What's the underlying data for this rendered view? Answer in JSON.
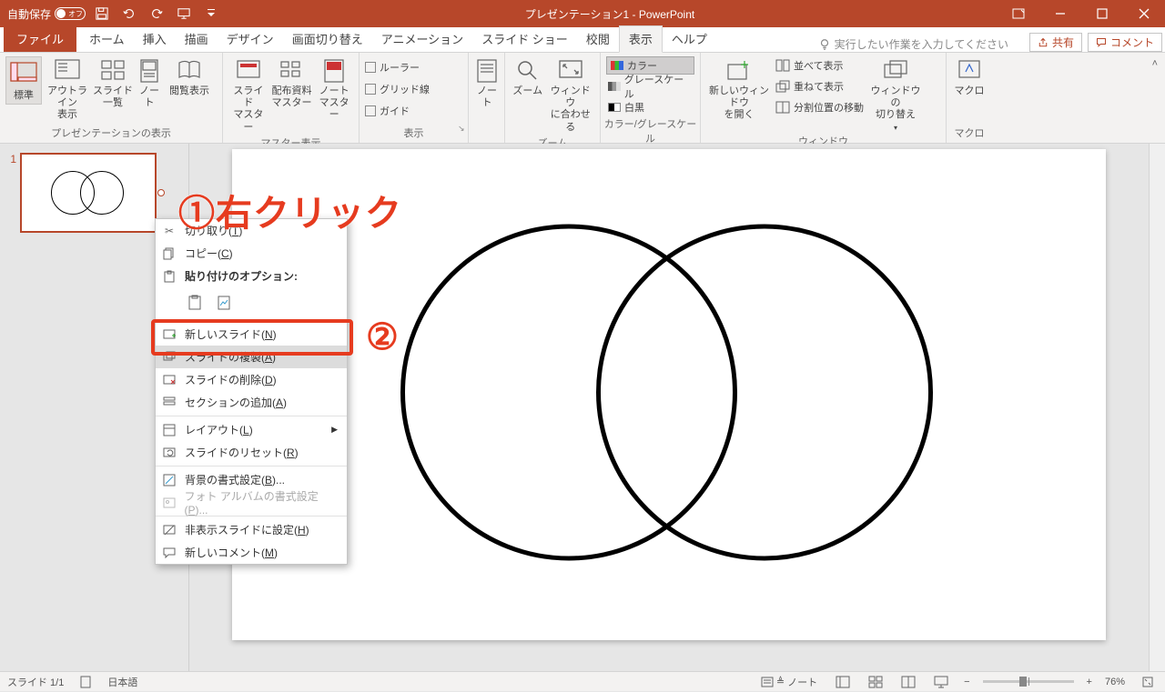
{
  "titlebar": {
    "autosave_label": "自動保存",
    "autosave_state": "オフ",
    "title": "プレゼンテーション1 - PowerPoint"
  },
  "tabs": {
    "file": "ファイル",
    "home": "ホーム",
    "insert": "挿入",
    "draw": "描画",
    "design": "デザイン",
    "transitions": "画面切り替え",
    "animations": "アニメーション",
    "slideshow": "スライド ショー",
    "review": "校閲",
    "view": "表示",
    "help": "ヘルプ",
    "search_placeholder": "実行したい作業を入力してください",
    "share": "共有",
    "comments": "コメント"
  },
  "ribbon": {
    "presentation_views": {
      "label": "プレゼンテーションの表示",
      "normal": "標準",
      "outline": "アウトライン\n表示",
      "sorter": "スライド\n一覧",
      "notes_page": "ノー\nト",
      "reading": "閲覧表示"
    },
    "master_views": {
      "label": "マスター表示",
      "slide_master": "スライド\nマスター",
      "handout_master": "配布資料\nマスター",
      "notes_master": "ノート\nマスター"
    },
    "show": {
      "label": "表示",
      "ruler": "ルーラー",
      "gridlines": "グリッド線",
      "guides": "ガイド"
    },
    "notes_group": {
      "notes": "ノー\nト"
    },
    "zoom": {
      "label": "ズーム",
      "zoom": "ズーム",
      "fit": "ウィンドウ\nに合わせる"
    },
    "color": {
      "label": "カラー/グレースケール",
      "color": "カラー",
      "grayscale": "グレースケール",
      "bw": "白黒"
    },
    "window": {
      "label": "ウィンドウ",
      "new_window": "新しいウィンドウ\nを開く",
      "arrange": "並べて表示",
      "cascade": "重ねて表示",
      "split": "分割位置の移動",
      "switch": "ウィンドウの\n切り替え"
    },
    "macros": {
      "label": "マクロ",
      "macros": "マクロ"
    }
  },
  "thumb": {
    "num": "1"
  },
  "context_menu": {
    "cut": "切り取り(T)",
    "copy": "コピー(C)",
    "paste_options": "貼り付けのオプション:",
    "new_slide": "新しいスライド(N)",
    "duplicate": "スライドの複製(A)",
    "delete": "スライドの削除(D)",
    "add_section": "セクションの追加(A)",
    "layout": "レイアウト(L)",
    "reset": "スライドのリセット(R)",
    "format_bg": "背景の書式設定(B)...",
    "photo_album": "フォト アルバムの書式設定(P)...",
    "hide": "非表示スライドに設定(H)",
    "new_comment": "新しいコメント(M)"
  },
  "annotations": {
    "one": "①右クリック",
    "two": "②"
  },
  "status": {
    "slide": "スライド 1/1",
    "lang": "日本語",
    "notes": "ノート",
    "zoom": "76%"
  }
}
